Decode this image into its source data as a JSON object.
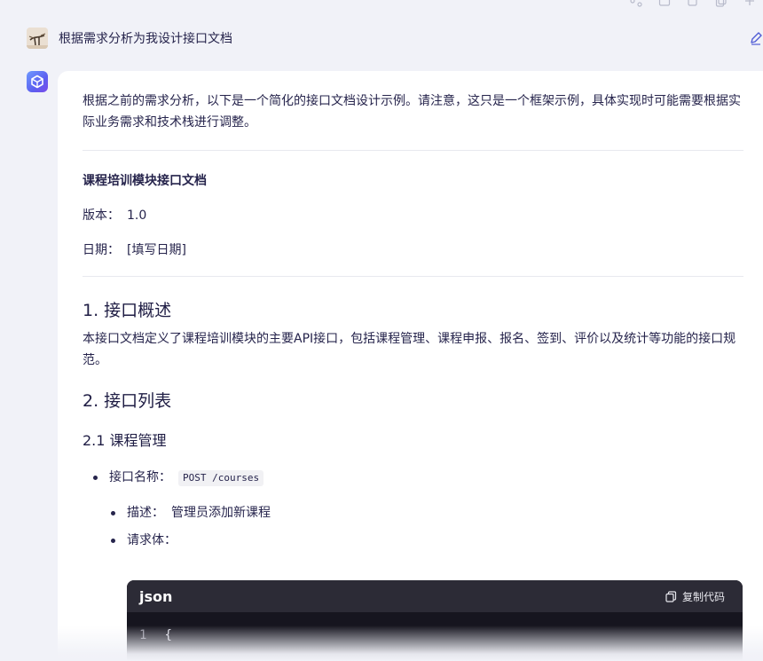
{
  "user_message": {
    "text": "根据需求分析为我设计接口文档"
  },
  "answer": {
    "intro": "根据之前的需求分析，以下是一个简化的接口文档设计示例。请注意，这只是一个框架示例，具体实现时可能需要根据实际业务需求和技术栈进行调整。",
    "doc_title": "课程培训模块接口文档",
    "version_label": "版本：",
    "version_value": "1.0",
    "date_label": "日期：",
    "date_value": "[填写日期]",
    "section1_title": "1. 接口概述",
    "section1_desc": "本接口文档定义了课程培训模块的主要API接口，包括课程管理、课程申报、报名、签到、评价以及统计等功能的接口规范。",
    "section2_title": "2. 接口列表",
    "subsection21_title": "2.1 课程管理",
    "api_name_label": "接口名称：",
    "api_name_value": "POST /courses",
    "desc_label": "描述：",
    "desc_value": "管理员添加新课程",
    "body_label": "请求体："
  },
  "code_block": {
    "language": "json",
    "copy_label": "复制代码",
    "line_number": "1",
    "first_line": "{"
  },
  "icons": {
    "toolbar": [
      "share-icon",
      "image-icon",
      "copy-icon",
      "duplicate-icon",
      "plus-icon"
    ],
    "edit": "pencil-icon",
    "copy": "copy-icon"
  },
  "colors": {
    "background": "#f1f2f8",
    "card": "#ffffff",
    "text": "#26244c",
    "accent": "#4f5bd5",
    "code_bg": "#16151f",
    "code_header": "#2c2b36"
  }
}
